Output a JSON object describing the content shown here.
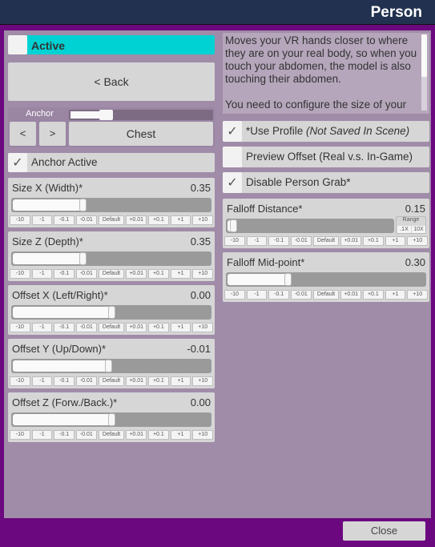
{
  "window": {
    "title": "Person",
    "close_label": "Close"
  },
  "colors": {
    "accent": "#00d2d4",
    "frame": "#6b077f",
    "titlebar": "#22314f",
    "panel": "#a08ca8"
  },
  "active": {
    "label": "Active",
    "checked": false
  },
  "back_label": "< Back",
  "anchor": {
    "label": "Anchor",
    "prev": "<",
    "next": ">",
    "value": "Chest",
    "slider_fraction": 0.3,
    "active_label": "Anchor Active",
    "active_checked": true
  },
  "description": "Moves your VR hands closer to where they are on your real body, so when you touch your abdomen, the model is also touching their abdomen.\n\nYou need to configure the size of your",
  "options": [
    {
      "label": "*Use Profile ",
      "label_italic": "(Not Saved In Scene)",
      "checked": true
    },
    {
      "label": "Preview Offset (Real v.s. In-Game)",
      "label_italic": "",
      "checked": false
    },
    {
      "label": "Disable Person Grab*",
      "label_italic": "",
      "checked": true
    }
  ],
  "step_buttons": [
    "-10",
    "-1",
    "-0.1",
    "-0.01",
    "Default",
    "+0.01",
    "+0.1",
    "+1",
    "+10"
  ],
  "range": {
    "label": "Range",
    "small": ".1X",
    "large": "10X"
  },
  "sliders": [
    {
      "label": "Size X (Width)*",
      "value": "0.35",
      "fraction": 0.35
    },
    {
      "label": "Size Z (Depth)*",
      "value": "0.35",
      "fraction": 0.35
    },
    {
      "label": "Offset X (Left/Right)*",
      "value": "0.00",
      "fraction": 0.5
    },
    {
      "label": "Offset Y (Up/Down)*",
      "value": "-0.01",
      "fraction": 0.485
    },
    {
      "label": "Offset Z (Forw./Back.)*",
      "value": "0.00",
      "fraction": 0.5
    },
    {
      "label": "Falloff Distance*",
      "value": "0.15",
      "fraction": 0.015
    },
    {
      "label": "Falloff Mid-point*",
      "value": "0.30",
      "fraction": 0.3
    }
  ]
}
